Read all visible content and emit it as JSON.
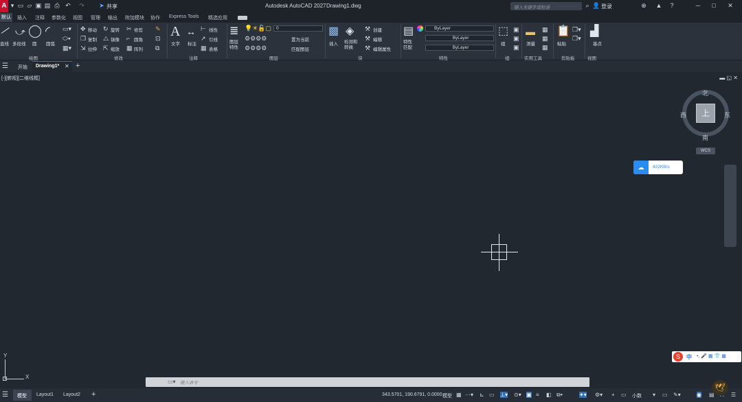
{
  "app": {
    "title": "Autodesk AutoCAD 2027",
    "file": "Drawing1.dwg",
    "share": "共享",
    "search_placeholder": "键入关键字或短语",
    "login": "登录"
  },
  "menu_tabs": [
    "默认",
    "插入",
    "注释",
    "参数化",
    "视图",
    "管理",
    "输出",
    "附加模块",
    "协作",
    "Express Tools",
    "精选应用"
  ],
  "ribbon": {
    "draw": {
      "line": "直线",
      "polyline": "多段线",
      "circle": "圆",
      "arc": "圆弧",
      "panel": "绘图"
    },
    "modify": {
      "move": "移动",
      "rotate": "旋转",
      "trim": "修剪",
      "copy": "复制",
      "mirror": "镜像",
      "fillet": "圆角",
      "stretch": "拉伸",
      "scale": "缩放",
      "array": "阵列",
      "panel": "修改"
    },
    "annotation": {
      "text": "文字",
      "dimension": "标注",
      "linear": "线性",
      "leader": "引线",
      "table": "表格",
      "panel": "注释"
    },
    "layers": {
      "props": "图层特性",
      "layer_value": "0",
      "make_current": "置为当前",
      "match": "匹配图层",
      "panel": "图层"
    },
    "block": {
      "insert": "插入",
      "create": "创建",
      "edit": "编辑",
      "edit_attr": "编辑属性",
      "panel": "块"
    },
    "inspect": {
      "check": "检测和转换"
    },
    "properties": {
      "match": "特性匹配",
      "color": "ByLayer",
      "linetype": "ByLayer",
      "lineweight": "ByLayer",
      "panel": "特性"
    },
    "groups": {
      "group": "组",
      "panel": "组"
    },
    "utilities": {
      "measure": "测量",
      "panel": "实用工具"
    },
    "clipboard": {
      "paste": "粘贴",
      "panel": "剪贴板"
    },
    "view": {
      "base": "基点",
      "panel": "视图"
    }
  },
  "doc_tabs": {
    "start": "开始",
    "drawing": "Drawing1*"
  },
  "viewport": {
    "label": "[-][俯视][二维线框]",
    "compass": {
      "n": "北",
      "s": "南",
      "e": "东",
      "w": "西",
      "top": "上"
    },
    "wcs": "WCS",
    "speed": "422KB/s"
  },
  "ucs": {
    "x": "X",
    "y": "Y"
  },
  "command": {
    "placeholder": "键入命令"
  },
  "ime": {
    "lang": "中"
  },
  "layout_tabs": [
    "模型",
    "Layout1",
    "Layout2"
  ],
  "status": {
    "coords": "343.5701, 190.6791, 0.0000",
    "model": "模型",
    "units": "小数"
  }
}
